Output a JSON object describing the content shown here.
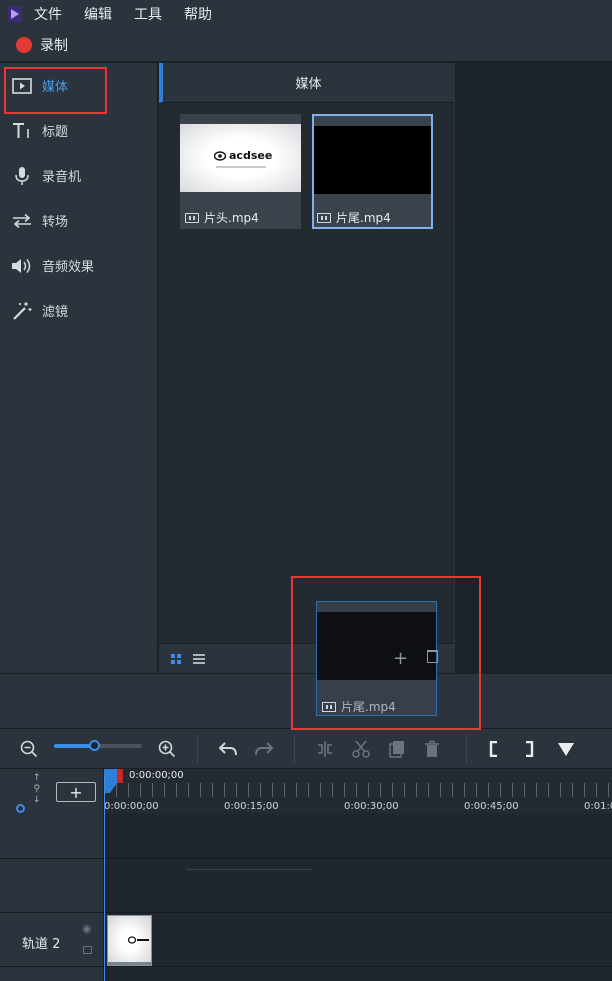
{
  "menu": [
    "文件",
    "编辑",
    "工具",
    "帮助"
  ],
  "record": {
    "label": "录制"
  },
  "sidebar": {
    "items": [
      {
        "label": "媒体",
        "icon": "play-icon",
        "active": true
      },
      {
        "label": "标题",
        "icon": "title-icon"
      },
      {
        "label": "录音机",
        "icon": "microphone-icon"
      },
      {
        "label": "转场",
        "icon": "transition-icon"
      },
      {
        "label": "音频效果",
        "icon": "volume-icon"
      },
      {
        "label": "滤镜",
        "icon": "magic-wand-icon"
      }
    ]
  },
  "media": {
    "title": "媒体",
    "files": [
      {
        "name": "片头.mp4",
        "thumb_text": "acdsee"
      },
      {
        "name": "片尾.mp4"
      }
    ],
    "drag_item": "片尾.mp4"
  },
  "timeline": {
    "playhead_time": "0:00:00;00",
    "ruler_labels": [
      "0:00:00;00",
      "0:00:15;00",
      "0:00:30;00",
      "0:00:45;00",
      "0:01:0"
    ],
    "tracks": [
      {
        "label": "轨道 2"
      }
    ],
    "zoom_level": 0.45
  },
  "colors": {
    "accent": "#3a8ee6",
    "record": "#e53935",
    "highlight_box": "#e53935"
  }
}
